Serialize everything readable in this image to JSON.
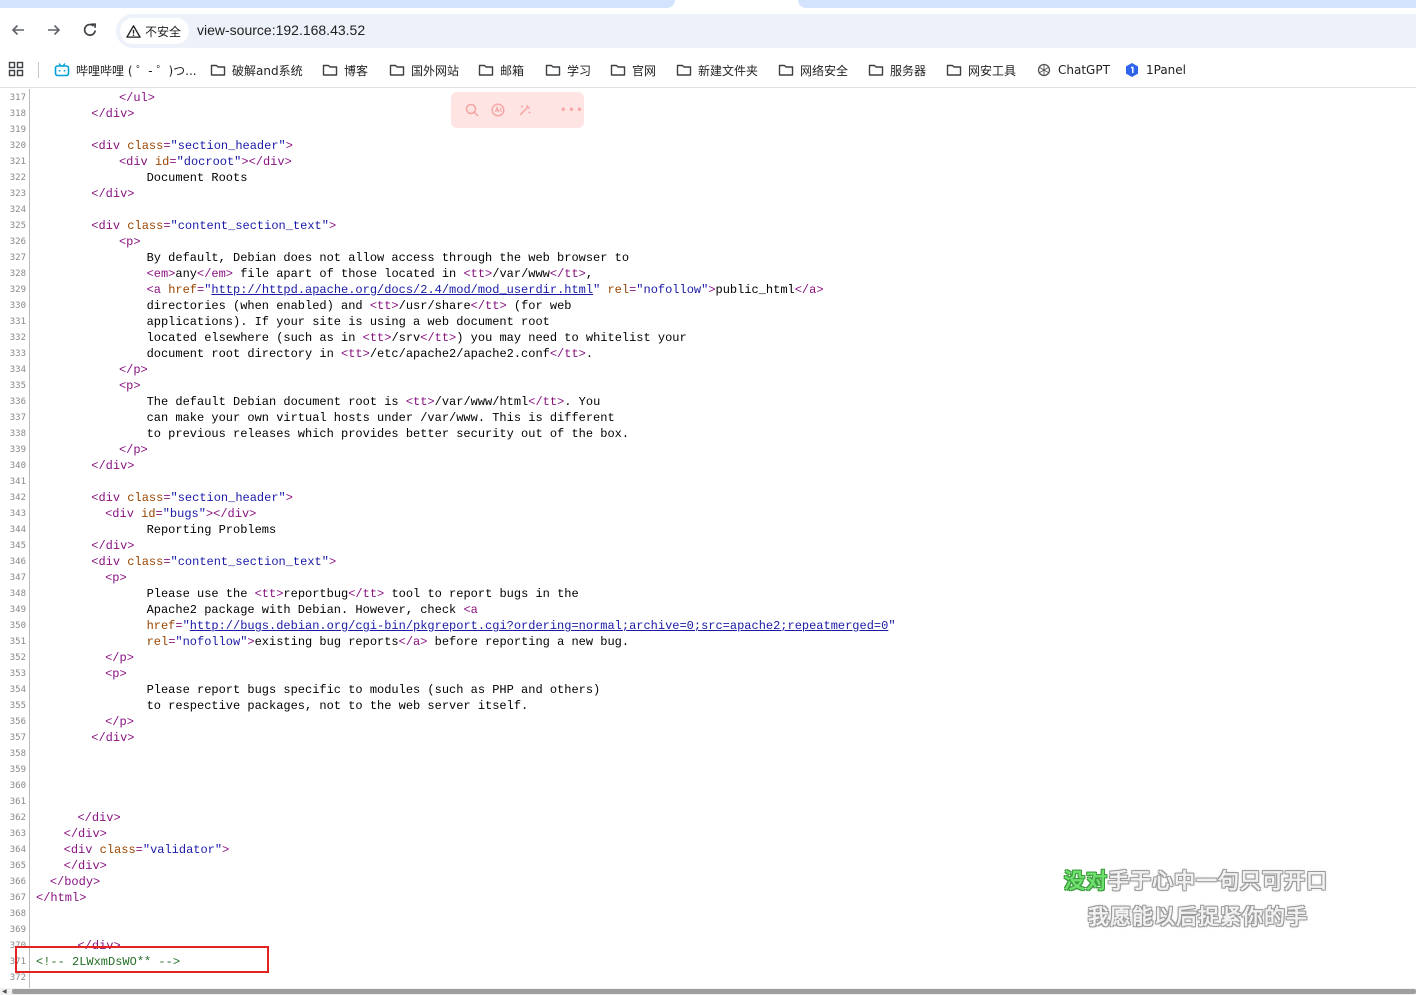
{
  "toolbar": {
    "security_label": "不安全",
    "url": "view-source:192.168.43.52"
  },
  "bookmarks": [
    {
      "label": "哔哩哔哩 ( ゜- ゜)つ...",
      "icon": "bilibili-icon"
    },
    {
      "label": "破解and系统",
      "icon": "folder-icon"
    },
    {
      "label": "博客",
      "icon": "folder-icon"
    },
    {
      "label": "国外网站",
      "icon": "folder-icon"
    },
    {
      "label": "邮箱",
      "icon": "folder-icon"
    },
    {
      "label": "学习",
      "icon": "folder-icon"
    },
    {
      "label": "官网",
      "icon": "folder-icon"
    },
    {
      "label": "新建文件夹",
      "icon": "folder-icon"
    },
    {
      "label": "网络安全",
      "icon": "folder-icon"
    },
    {
      "label": "服务器",
      "icon": "folder-icon"
    },
    {
      "label": "网安工具",
      "icon": "folder-icon"
    },
    {
      "label": "ChatGPT",
      "icon": "chatgpt-icon"
    },
    {
      "label": "1Panel",
      "icon": "1panel-icon"
    }
  ],
  "source": {
    "lines": [
      {
        "n": "317",
        "indent": 12,
        "segs": [
          [
            "tg",
            "</ul>"
          ]
        ]
      },
      {
        "n": "318",
        "indent": 8,
        "segs": [
          [
            "tg",
            "</div>"
          ]
        ]
      },
      {
        "n": "319",
        "indent": 0,
        "segs": []
      },
      {
        "n": "320",
        "indent": 8,
        "segs": [
          [
            "tg",
            "<div "
          ],
          [
            "an",
            "class"
          ],
          [
            "tg",
            "="
          ],
          [
            "av",
            "\"section_header\""
          ],
          [
            "tg",
            ">"
          ]
        ]
      },
      {
        "n": "321",
        "indent": 12,
        "segs": [
          [
            "tg",
            "<div "
          ],
          [
            "an",
            "id"
          ],
          [
            "tg",
            "="
          ],
          [
            "av",
            "\"docroot\""
          ],
          [
            "tg",
            "></div>"
          ]
        ]
      },
      {
        "n": "322",
        "indent": 16,
        "segs": [
          [
            "tx",
            "Document Roots"
          ]
        ]
      },
      {
        "n": "323",
        "indent": 8,
        "segs": [
          [
            "tg",
            "</div>"
          ]
        ]
      },
      {
        "n": "324",
        "indent": 0,
        "segs": []
      },
      {
        "n": "325",
        "indent": 8,
        "segs": [
          [
            "tg",
            "<div "
          ],
          [
            "an",
            "class"
          ],
          [
            "tg",
            "="
          ],
          [
            "av",
            "\"content_section_text\""
          ],
          [
            "tg",
            ">"
          ]
        ]
      },
      {
        "n": "326",
        "indent": 12,
        "segs": [
          [
            "tg",
            "<p>"
          ]
        ]
      },
      {
        "n": "327",
        "indent": 16,
        "segs": [
          [
            "tx",
            "By default, Debian does not allow access through the web browser to"
          ]
        ]
      },
      {
        "n": "328",
        "indent": 16,
        "segs": [
          [
            "tg",
            "<em>"
          ],
          [
            "tx",
            "any"
          ],
          [
            "tg",
            "</em>"
          ],
          [
            "tx",
            " file apart of those located in "
          ],
          [
            "tg",
            "<tt>"
          ],
          [
            "tx",
            "/var/www"
          ],
          [
            "tg",
            "</tt>"
          ],
          [
            "tx",
            ","
          ]
        ]
      },
      {
        "n": "329",
        "indent": 16,
        "segs": [
          [
            "tg",
            "<a "
          ],
          [
            "an",
            "href"
          ],
          [
            "tg",
            "="
          ],
          [
            "av",
            "\""
          ],
          [
            "lk",
            "http://httpd.apache.org/docs/2.4/mod/mod_userdir.html"
          ],
          [
            "av",
            "\""
          ],
          [
            "tx",
            " "
          ],
          [
            "an",
            "rel"
          ],
          [
            "tg",
            "="
          ],
          [
            "av",
            "\"nofollow\""
          ],
          [
            "tg",
            ">"
          ],
          [
            "tx",
            "public_html"
          ],
          [
            "tg",
            "</a>"
          ]
        ]
      },
      {
        "n": "330",
        "indent": 16,
        "segs": [
          [
            "tx",
            "directories (when enabled) and "
          ],
          [
            "tg",
            "<tt>"
          ],
          [
            "tx",
            "/usr/share"
          ],
          [
            "tg",
            "</tt>"
          ],
          [
            "tx",
            " (for web"
          ]
        ]
      },
      {
        "n": "331",
        "indent": 16,
        "segs": [
          [
            "tx",
            "applications). If your site is using a web document root"
          ]
        ]
      },
      {
        "n": "332",
        "indent": 16,
        "segs": [
          [
            "tx",
            "located elsewhere (such as in "
          ],
          [
            "tg",
            "<tt>"
          ],
          [
            "tx",
            "/srv"
          ],
          [
            "tg",
            "</tt>"
          ],
          [
            "tx",
            ") you may need to whitelist your"
          ]
        ]
      },
      {
        "n": "333",
        "indent": 16,
        "segs": [
          [
            "tx",
            "document root directory in "
          ],
          [
            "tg",
            "<tt>"
          ],
          [
            "tx",
            "/etc/apache2/apache2.conf"
          ],
          [
            "tg",
            "</tt>"
          ],
          [
            "tx",
            "."
          ]
        ]
      },
      {
        "n": "334",
        "indent": 12,
        "segs": [
          [
            "tg",
            "</p>"
          ]
        ]
      },
      {
        "n": "335",
        "indent": 12,
        "segs": [
          [
            "tg",
            "<p>"
          ]
        ]
      },
      {
        "n": "336",
        "indent": 16,
        "segs": [
          [
            "tx",
            "The default Debian document root is "
          ],
          [
            "tg",
            "<tt>"
          ],
          [
            "tx",
            "/var/www/html"
          ],
          [
            "tg",
            "</tt>"
          ],
          [
            "tx",
            ". You"
          ]
        ]
      },
      {
        "n": "337",
        "indent": 16,
        "segs": [
          [
            "tx",
            "can make your own virtual hosts under /var/www. This is different"
          ]
        ]
      },
      {
        "n": "338",
        "indent": 16,
        "segs": [
          [
            "tx",
            "to previous releases which provides better security out of the box."
          ]
        ]
      },
      {
        "n": "339",
        "indent": 12,
        "segs": [
          [
            "tg",
            "</p>"
          ]
        ]
      },
      {
        "n": "340",
        "indent": 8,
        "segs": [
          [
            "tg",
            "</div>"
          ]
        ]
      },
      {
        "n": "341",
        "indent": 0,
        "segs": []
      },
      {
        "n": "342",
        "indent": 8,
        "segs": [
          [
            "tg",
            "<div "
          ],
          [
            "an",
            "class"
          ],
          [
            "tg",
            "="
          ],
          [
            "av",
            "\"section_header\""
          ],
          [
            "tg",
            ">"
          ]
        ]
      },
      {
        "n": "343",
        "indent": 10,
        "segs": [
          [
            "tg",
            "<div "
          ],
          [
            "an",
            "id"
          ],
          [
            "tg",
            "="
          ],
          [
            "av",
            "\"bugs\""
          ],
          [
            "tg",
            "></div>"
          ]
        ]
      },
      {
        "n": "344",
        "indent": 16,
        "segs": [
          [
            "tx",
            "Reporting Problems"
          ]
        ]
      },
      {
        "n": "345",
        "indent": 8,
        "segs": [
          [
            "tg",
            "</div>"
          ]
        ]
      },
      {
        "n": "346",
        "indent": 8,
        "segs": [
          [
            "tg",
            "<div "
          ],
          [
            "an",
            "class"
          ],
          [
            "tg",
            "="
          ],
          [
            "av",
            "\"content_section_text\""
          ],
          [
            "tg",
            ">"
          ]
        ]
      },
      {
        "n": "347",
        "indent": 10,
        "segs": [
          [
            "tg",
            "<p>"
          ]
        ]
      },
      {
        "n": "348",
        "indent": 16,
        "segs": [
          [
            "tx",
            "Please use the "
          ],
          [
            "tg",
            "<tt>"
          ],
          [
            "tx",
            "reportbug"
          ],
          [
            "tg",
            "</tt>"
          ],
          [
            "tx",
            " tool to report bugs in the"
          ]
        ]
      },
      {
        "n": "349",
        "indent": 16,
        "segs": [
          [
            "tx",
            "Apache2 package with Debian. However, check "
          ],
          [
            "tg",
            "<a"
          ]
        ]
      },
      {
        "n": "350",
        "indent": 16,
        "segs": [
          [
            "an",
            "href"
          ],
          [
            "tg",
            "="
          ],
          [
            "av",
            "\""
          ],
          [
            "lk",
            "http://bugs.debian.org/cgi-bin/pkgreport.cgi?ordering=normal;archive=0;src=apache2;repeatmerged=0"
          ],
          [
            "av",
            "\""
          ]
        ]
      },
      {
        "n": "351",
        "indent": 16,
        "segs": [
          [
            "an",
            "rel"
          ],
          [
            "tg",
            "="
          ],
          [
            "av",
            "\"nofollow\""
          ],
          [
            "tg",
            ">"
          ],
          [
            "tx",
            "existing bug reports"
          ],
          [
            "tg",
            "</a>"
          ],
          [
            "tx",
            " before reporting a new bug."
          ]
        ]
      },
      {
        "n": "352",
        "indent": 10,
        "segs": [
          [
            "tg",
            "</p>"
          ]
        ]
      },
      {
        "n": "353",
        "indent": 10,
        "segs": [
          [
            "tg",
            "<p>"
          ]
        ]
      },
      {
        "n": "354",
        "indent": 16,
        "segs": [
          [
            "tx",
            "Please report bugs specific to modules (such as PHP and others)"
          ]
        ]
      },
      {
        "n": "355",
        "indent": 16,
        "segs": [
          [
            "tx",
            "to respective packages, not to the web server itself."
          ]
        ]
      },
      {
        "n": "356",
        "indent": 10,
        "segs": [
          [
            "tg",
            "</p>"
          ]
        ]
      },
      {
        "n": "357",
        "indent": 8,
        "segs": [
          [
            "tg",
            "</div>"
          ]
        ]
      },
      {
        "n": "358",
        "indent": 0,
        "segs": []
      },
      {
        "n": "359",
        "indent": 0,
        "segs": []
      },
      {
        "n": "360",
        "indent": 0,
        "segs": []
      },
      {
        "n": "361",
        "indent": 0,
        "segs": []
      },
      {
        "n": "362",
        "indent": 6,
        "segs": [
          [
            "tg",
            "</div>"
          ]
        ]
      },
      {
        "n": "363",
        "indent": 4,
        "segs": [
          [
            "tg",
            "</div>"
          ]
        ]
      },
      {
        "n": "364",
        "indent": 4,
        "segs": [
          [
            "tg",
            "<div "
          ],
          [
            "an",
            "class"
          ],
          [
            "tg",
            "="
          ],
          [
            "av",
            "\"validator\""
          ],
          [
            "tg",
            ">"
          ]
        ]
      },
      {
        "n": "365",
        "indent": 4,
        "segs": [
          [
            "tg",
            "</div>"
          ]
        ]
      },
      {
        "n": "366",
        "indent": 2,
        "segs": [
          [
            "tg",
            "</body>"
          ]
        ]
      },
      {
        "n": "367",
        "indent": 0,
        "segs": [
          [
            "tg",
            "</html>"
          ]
        ]
      },
      {
        "n": "368",
        "indent": 0,
        "segs": []
      },
      {
        "n": "369",
        "indent": 0,
        "segs": []
      },
      {
        "n": "370",
        "indent": 6,
        "segs": [
          [
            "tg",
            "</div>"
          ]
        ]
      },
      {
        "n": "371",
        "indent": 0,
        "segs": [
          [
            "cm",
            "<!-- 2LWxmDsWO** -->"
          ]
        ]
      },
      {
        "n": "372",
        "indent": 0,
        "segs": []
      }
    ]
  },
  "lyrics": {
    "line1_hot": "没对",
    "line1_rest": "手于心中一句只可开口",
    "line2": "我愿能以后捉紧你的手"
  }
}
